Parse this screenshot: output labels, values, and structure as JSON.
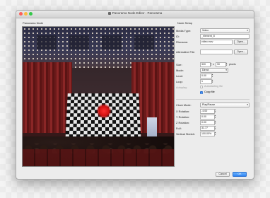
{
  "window": {
    "title": "Panorama Node Editor - Panorama",
    "icon": "panorama-file-icon"
  },
  "left_group": {
    "title": "Panorama Node"
  },
  "right_group": {
    "title": "Node Setup"
  },
  "fields": {
    "media_type": {
      "label": "Media Type:",
      "value": "Video"
    },
    "id": {
      "label": "ID:",
      "value": "_element_8"
    },
    "filename": {
      "label": "Filename:",
      "value": "video.mov",
      "button": "Open..."
    },
    "alt_file": {
      "label": "Alternative File:",
      "value": "",
      "button": "Open..."
    },
    "size": {
      "label": "Size:",
      "width": "320",
      "height": "90",
      "separator": "x",
      "unit": "pixels"
    },
    "mode": {
      "label": "Mode:",
      "value": "Direct"
    },
    "level": {
      "label": "Level:",
      "value": "0.00"
    },
    "loop": {
      "label": "Loop:",
      "value": "1"
    },
    "autoplay": {
      "label": "Autoplay:",
      "checkbox_label": "Autostarting file",
      "checked": false,
      "enabled": false
    },
    "copy_file": {
      "checkbox_label": "Copy file",
      "checked": true
    },
    "clock_mode": {
      "label": "Clock Mode:",
      "value": "Play/Pause"
    },
    "x_rotation": {
      "label": "X Rotation:",
      "value": "-4.00"
    },
    "y_rotation": {
      "label": "Y Rotation:",
      "value": "0.00"
    },
    "z_rotation": {
      "label": "Z Rotation:",
      "value": "0.00"
    },
    "fov": {
      "label": "FoV:",
      "value": "31.77"
    },
    "vertical_stretch": {
      "label": "Vertical Stretch:",
      "value": "100.00%"
    }
  },
  "footer": {
    "cancel_label": "Cancel",
    "ok_label": "OK"
  },
  "colors": {
    "accent": "#2f86f6",
    "close": "#fc605c",
    "minimize": "#fdbc40",
    "maximize": "#34c84a"
  }
}
